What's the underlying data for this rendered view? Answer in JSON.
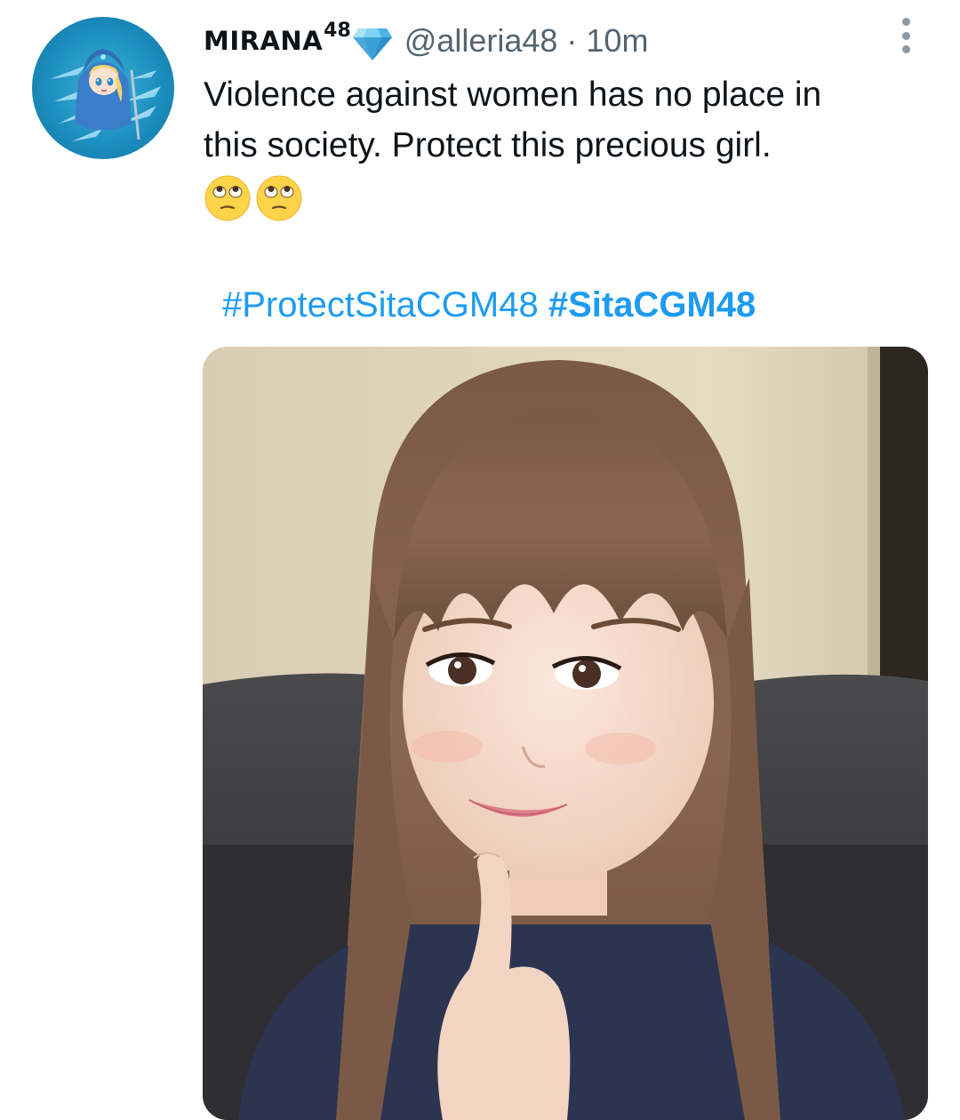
{
  "tweet": {
    "display_name": "MIRANA",
    "display_name_superscript": "48",
    "badge_icon": "blue-diamond-icon",
    "handle": "@alleria48",
    "separator": "·",
    "timestamp": "10m",
    "text_line_1": "Violence against women has no place in",
    "text_line_2": "this society. Protect this precious girl.",
    "emojis": [
      "face-with-rolling-eyes-emoji",
      "face-with-rolling-eyes-emoji"
    ],
    "hashtags": [
      {
        "text": "#ProtectSitaCGM48",
        "bold": false
      },
      {
        "text": "#SitaCGM48",
        "bold": true
      }
    ],
    "avatar_icon": "anime-character-avatar",
    "media_description_icon": "selfie-photo",
    "more_icon": "more-options-icon"
  },
  "colors": {
    "link": "#1d9bf0",
    "text_primary": "#0f1419",
    "text_secondary": "#536471",
    "avatar_background": "#1c8fc0"
  }
}
